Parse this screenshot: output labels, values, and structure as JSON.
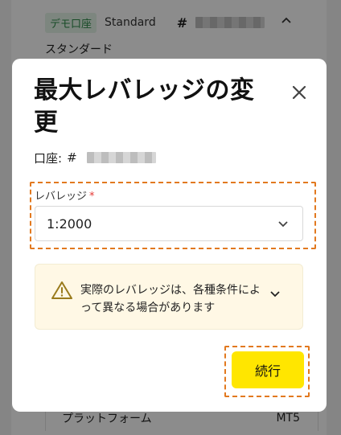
{
  "background": {
    "account_tag": "デモ口座",
    "account_type": "Standard",
    "hash": "#",
    "subtitle": "スタンダード",
    "row_label": "プラットフォーム",
    "row_value": "MT5"
  },
  "modal": {
    "title": "最大レバレッジの変更",
    "account_label": "口座:",
    "account_hash": "#",
    "leverage_label": "レバレッジ",
    "required_mark": "*",
    "leverage_value": "1:2000",
    "notice_text": "実際のレバレッジは、各種条件によって異なる場合があります",
    "continue_label": "続行"
  },
  "colors": {
    "accent_button": "#ffe600",
    "highlight_border": "#e2791f",
    "notice_bg": "#fff8e5",
    "required": "#e53935"
  },
  "icons": {
    "close": "close-icon",
    "select": "chevron-down-icon",
    "notice": "warning-icon",
    "notice_expand": "chevron-down-icon",
    "background_collapse": "chevron-up-icon"
  }
}
